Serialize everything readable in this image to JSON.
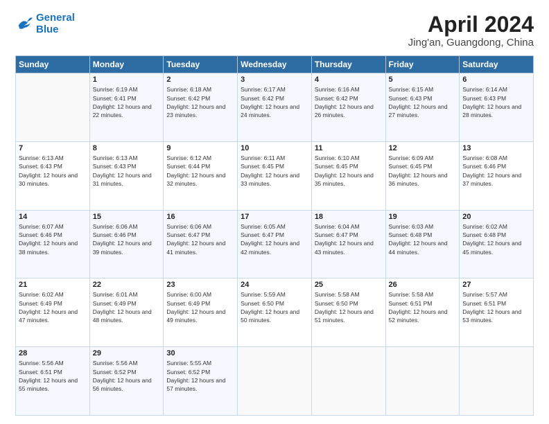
{
  "logo": {
    "text_general": "General",
    "text_blue": "Blue"
  },
  "header": {
    "month_title": "April 2024",
    "subtitle": "Jing'an, Guangdong, China"
  },
  "weekdays": [
    "Sunday",
    "Monday",
    "Tuesday",
    "Wednesday",
    "Thursday",
    "Friday",
    "Saturday"
  ],
  "weeks": [
    [
      {
        "day": "",
        "sunrise": "",
        "sunset": "",
        "daylight": ""
      },
      {
        "day": "1",
        "sunrise": "Sunrise: 6:19 AM",
        "sunset": "Sunset: 6:41 PM",
        "daylight": "Daylight: 12 hours and 22 minutes."
      },
      {
        "day": "2",
        "sunrise": "Sunrise: 6:18 AM",
        "sunset": "Sunset: 6:42 PM",
        "daylight": "Daylight: 12 hours and 23 minutes."
      },
      {
        "day": "3",
        "sunrise": "Sunrise: 6:17 AM",
        "sunset": "Sunset: 6:42 PM",
        "daylight": "Daylight: 12 hours and 24 minutes."
      },
      {
        "day": "4",
        "sunrise": "Sunrise: 6:16 AM",
        "sunset": "Sunset: 6:42 PM",
        "daylight": "Daylight: 12 hours and 26 minutes."
      },
      {
        "day": "5",
        "sunrise": "Sunrise: 6:15 AM",
        "sunset": "Sunset: 6:43 PM",
        "daylight": "Daylight: 12 hours and 27 minutes."
      },
      {
        "day": "6",
        "sunrise": "Sunrise: 6:14 AM",
        "sunset": "Sunset: 6:43 PM",
        "daylight": "Daylight: 12 hours and 28 minutes."
      }
    ],
    [
      {
        "day": "7",
        "sunrise": "Sunrise: 6:13 AM",
        "sunset": "Sunset: 6:43 PM",
        "daylight": "Daylight: 12 hours and 30 minutes."
      },
      {
        "day": "8",
        "sunrise": "Sunrise: 6:13 AM",
        "sunset": "Sunset: 6:43 PM",
        "daylight": "Daylight: 12 hours and 31 minutes."
      },
      {
        "day": "9",
        "sunrise": "Sunrise: 6:12 AM",
        "sunset": "Sunset: 6:44 PM",
        "daylight": "Daylight: 12 hours and 32 minutes."
      },
      {
        "day": "10",
        "sunrise": "Sunrise: 6:11 AM",
        "sunset": "Sunset: 6:45 PM",
        "daylight": "Daylight: 12 hours and 33 minutes."
      },
      {
        "day": "11",
        "sunrise": "Sunrise: 6:10 AM",
        "sunset": "Sunset: 6:45 PM",
        "daylight": "Daylight: 12 hours and 35 minutes."
      },
      {
        "day": "12",
        "sunrise": "Sunrise: 6:09 AM",
        "sunset": "Sunset: 6:45 PM",
        "daylight": "Daylight: 12 hours and 36 minutes."
      },
      {
        "day": "13",
        "sunrise": "Sunrise: 6:08 AM",
        "sunset": "Sunset: 6:46 PM",
        "daylight": "Daylight: 12 hours and 37 minutes."
      }
    ],
    [
      {
        "day": "14",
        "sunrise": "Sunrise: 6:07 AM",
        "sunset": "Sunset: 6:46 PM",
        "daylight": "Daylight: 12 hours and 38 minutes."
      },
      {
        "day": "15",
        "sunrise": "Sunrise: 6:06 AM",
        "sunset": "Sunset: 6:46 PM",
        "daylight": "Daylight: 12 hours and 39 minutes."
      },
      {
        "day": "16",
        "sunrise": "Sunrise: 6:06 AM",
        "sunset": "Sunset: 6:47 PM",
        "daylight": "Daylight: 12 hours and 41 minutes."
      },
      {
        "day": "17",
        "sunrise": "Sunrise: 6:05 AM",
        "sunset": "Sunset: 6:47 PM",
        "daylight": "Daylight: 12 hours and 42 minutes."
      },
      {
        "day": "18",
        "sunrise": "Sunrise: 6:04 AM",
        "sunset": "Sunset: 6:47 PM",
        "daylight": "Daylight: 12 hours and 43 minutes."
      },
      {
        "day": "19",
        "sunrise": "Sunrise: 6:03 AM",
        "sunset": "Sunset: 6:48 PM",
        "daylight": "Daylight: 12 hours and 44 minutes."
      },
      {
        "day": "20",
        "sunrise": "Sunrise: 6:02 AM",
        "sunset": "Sunset: 6:48 PM",
        "daylight": "Daylight: 12 hours and 45 minutes."
      }
    ],
    [
      {
        "day": "21",
        "sunrise": "Sunrise: 6:02 AM",
        "sunset": "Sunset: 6:49 PM",
        "daylight": "Daylight: 12 hours and 47 minutes."
      },
      {
        "day": "22",
        "sunrise": "Sunrise: 6:01 AM",
        "sunset": "Sunset: 6:49 PM",
        "daylight": "Daylight: 12 hours and 48 minutes."
      },
      {
        "day": "23",
        "sunrise": "Sunrise: 6:00 AM",
        "sunset": "Sunset: 6:49 PM",
        "daylight": "Daylight: 12 hours and 49 minutes."
      },
      {
        "day": "24",
        "sunrise": "Sunrise: 5:59 AM",
        "sunset": "Sunset: 6:50 PM",
        "daylight": "Daylight: 12 hours and 50 minutes."
      },
      {
        "day": "25",
        "sunrise": "Sunrise: 5:58 AM",
        "sunset": "Sunset: 6:50 PM",
        "daylight": "Daylight: 12 hours and 51 minutes."
      },
      {
        "day": "26",
        "sunrise": "Sunrise: 5:58 AM",
        "sunset": "Sunset: 6:51 PM",
        "daylight": "Daylight: 12 hours and 52 minutes."
      },
      {
        "day": "27",
        "sunrise": "Sunrise: 5:57 AM",
        "sunset": "Sunset: 6:51 PM",
        "daylight": "Daylight: 12 hours and 53 minutes."
      }
    ],
    [
      {
        "day": "28",
        "sunrise": "Sunrise: 5:56 AM",
        "sunset": "Sunset: 6:51 PM",
        "daylight": "Daylight: 12 hours and 55 minutes."
      },
      {
        "day": "29",
        "sunrise": "Sunrise: 5:56 AM",
        "sunset": "Sunset: 6:52 PM",
        "daylight": "Daylight: 12 hours and 56 minutes."
      },
      {
        "day": "30",
        "sunrise": "Sunrise: 5:55 AM",
        "sunset": "Sunset: 6:52 PM",
        "daylight": "Daylight: 12 hours and 57 minutes."
      },
      {
        "day": "",
        "sunrise": "",
        "sunset": "",
        "daylight": ""
      },
      {
        "day": "",
        "sunrise": "",
        "sunset": "",
        "daylight": ""
      },
      {
        "day": "",
        "sunrise": "",
        "sunset": "",
        "daylight": ""
      },
      {
        "day": "",
        "sunrise": "",
        "sunset": "",
        "daylight": ""
      }
    ]
  ]
}
